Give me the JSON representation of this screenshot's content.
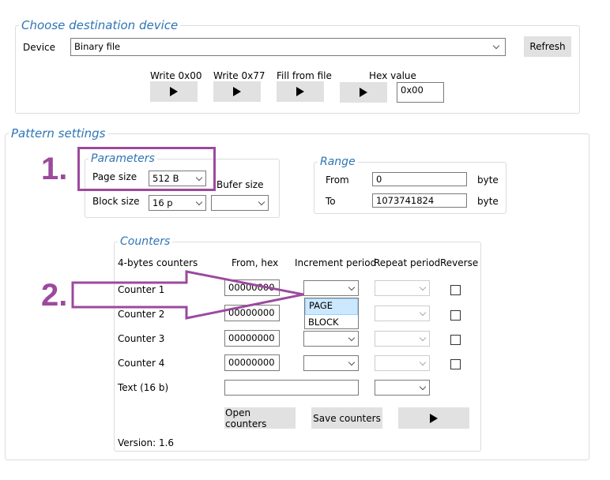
{
  "destination": {
    "legend": "Choose destination device",
    "device_label": "Device",
    "device_value": "Binary file",
    "refresh_label": "Refresh",
    "write00_label": "Write 0x00",
    "write77_label": "Write 0x77",
    "fill_label": "Fill from file",
    "hex_label": "Hex value",
    "hex_value": "0x00"
  },
  "pattern": {
    "legend": "Pattern settings",
    "parameters": {
      "legend": "Parameters",
      "page_size_label": "Page size",
      "page_size_value": "512 B",
      "block_size_label": "Block size",
      "block_size_value": "16 p",
      "bufer_label": "Bufer size",
      "bufer_value": ""
    },
    "range": {
      "legend": "Range",
      "from_label": "From",
      "from_value": "0",
      "to_label": "To",
      "to_value": "1073741824",
      "unit_from": "byte",
      "unit_to": "byte"
    },
    "counters": {
      "legend": "Counters",
      "headers": [
        "4-bytes counters",
        "From, hex",
        "Increment period",
        "Repeat period",
        "Reverse"
      ],
      "rows": [
        {
          "label": "Counter 1",
          "from": "00000000"
        },
        {
          "label": "Counter 2",
          "from": "00000000"
        },
        {
          "label": "Counter 3",
          "from": "00000000"
        },
        {
          "label": "Counter 4",
          "from": "00000000"
        }
      ],
      "text_label": "Text (16 b)",
      "text_value": "",
      "dropdown_options": [
        "PAGE",
        "BLOCK"
      ],
      "open_label": "Open counters",
      "save_label": "Save counters",
      "version": "Version: 1.6"
    }
  },
  "annotations": {
    "step1": "1.",
    "step2": "2.",
    "color": "#9b4a9e"
  }
}
